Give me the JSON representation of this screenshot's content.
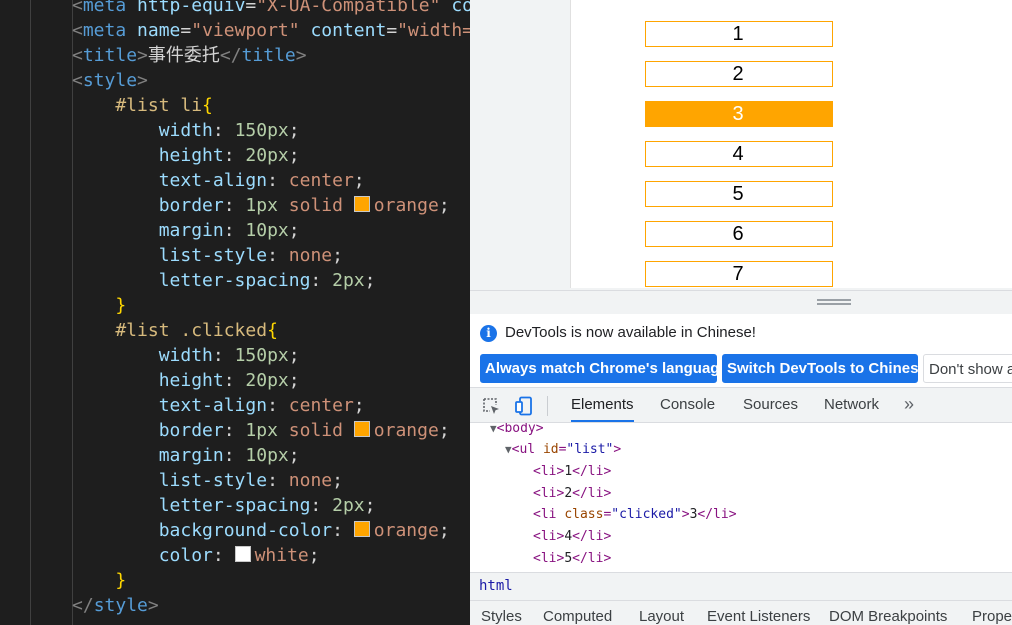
{
  "editor": {
    "lines": [
      [
        [
          "t-br",
          "<"
        ],
        [
          "t-tag",
          "meta "
        ],
        [
          "t-attr",
          "http-equiv"
        ],
        [
          "t-txt",
          "="
        ],
        [
          "t-str",
          "\"X-UA-Compatible\" "
        ],
        [
          "t-attr",
          "co"
        ]
      ],
      [
        [
          "t-br",
          "<"
        ],
        [
          "t-tag",
          "meta "
        ],
        [
          "t-attr",
          "name"
        ],
        [
          "t-txt",
          "="
        ],
        [
          "t-str",
          "\"viewport\" "
        ],
        [
          "t-attr",
          "content"
        ],
        [
          "t-txt",
          "="
        ],
        [
          "t-str",
          "\"width="
        ]
      ],
      [
        [
          "t-br",
          "<"
        ],
        [
          "t-tag",
          "title"
        ],
        [
          "t-br",
          ">"
        ],
        [
          "t-txt",
          "事件委托"
        ],
        [
          "t-br",
          "</"
        ],
        [
          "t-tag",
          "title"
        ],
        [
          "t-br",
          ">"
        ]
      ],
      [
        [
          "t-br",
          "<"
        ],
        [
          "t-tag",
          "style"
        ],
        [
          "t-br",
          ">"
        ]
      ],
      [
        [
          "t-sel",
          "    #list li"
        ],
        [
          "t-brace",
          "{"
        ]
      ],
      [
        [
          "t-prop",
          "        width"
        ],
        [
          "t-pun",
          ": "
        ],
        [
          "t-num",
          "150px"
        ],
        [
          "t-pun",
          ";"
        ]
      ],
      [
        [
          "t-prop",
          "        height"
        ],
        [
          "t-pun",
          ": "
        ],
        [
          "t-num",
          "20px"
        ],
        [
          "t-pun",
          ";"
        ]
      ],
      [
        [
          "t-prop",
          "        text-align"
        ],
        [
          "t-pun",
          ": "
        ],
        [
          "t-val",
          "center"
        ],
        [
          "t-pun",
          ";"
        ]
      ],
      [
        [
          "t-prop",
          "        border"
        ],
        [
          "t-pun",
          ": "
        ],
        [
          "t-num",
          "1px "
        ],
        [
          "t-val",
          "solid "
        ],
        [
          "swatch",
          "#FFA500"
        ],
        [
          "t-val",
          "orange"
        ],
        [
          "t-pun",
          ";"
        ]
      ],
      [
        [
          "t-prop",
          "        margin"
        ],
        [
          "t-pun",
          ": "
        ],
        [
          "t-num",
          "10px"
        ],
        [
          "t-pun",
          ";"
        ]
      ],
      [
        [
          "t-prop",
          "        list-style"
        ],
        [
          "t-pun",
          ": "
        ],
        [
          "t-val",
          "none"
        ],
        [
          "t-pun",
          ";"
        ]
      ],
      [
        [
          "t-prop",
          "        letter-spacing"
        ],
        [
          "t-pun",
          ": "
        ],
        [
          "t-num",
          "2px"
        ],
        [
          "t-pun",
          ";"
        ]
      ],
      [
        [
          "t-brace",
          "    }"
        ]
      ],
      [
        [
          "t-sel",
          "    #list .clicked"
        ],
        [
          "t-brace",
          "{"
        ]
      ],
      [
        [
          "t-prop",
          "        width"
        ],
        [
          "t-pun",
          ": "
        ],
        [
          "t-num",
          "150px"
        ],
        [
          "t-pun",
          ";"
        ]
      ],
      [
        [
          "t-prop",
          "        height"
        ],
        [
          "t-pun",
          ": "
        ],
        [
          "t-num",
          "20px"
        ],
        [
          "t-pun",
          ";"
        ]
      ],
      [
        [
          "t-prop",
          "        text-align"
        ],
        [
          "t-pun",
          ": "
        ],
        [
          "t-val",
          "center"
        ],
        [
          "t-pun",
          ";"
        ]
      ],
      [
        [
          "t-prop",
          "        border"
        ],
        [
          "t-pun",
          ": "
        ],
        [
          "t-num",
          "1px "
        ],
        [
          "t-val",
          "solid "
        ],
        [
          "swatch",
          "#FFA500"
        ],
        [
          "t-val",
          "orange"
        ],
        [
          "t-pun",
          ";"
        ]
      ],
      [
        [
          "t-prop",
          "        margin"
        ],
        [
          "t-pun",
          ": "
        ],
        [
          "t-num",
          "10px"
        ],
        [
          "t-pun",
          ";"
        ]
      ],
      [
        [
          "t-prop",
          "        list-style"
        ],
        [
          "t-pun",
          ": "
        ],
        [
          "t-val",
          "none"
        ],
        [
          "t-pun",
          ";"
        ]
      ],
      [
        [
          "t-prop",
          "        letter-spacing"
        ],
        [
          "t-pun",
          ": "
        ],
        [
          "t-num",
          "2px"
        ],
        [
          "t-pun",
          ";"
        ]
      ],
      [
        [
          "t-prop",
          "        background-color"
        ],
        [
          "t-pun",
          ": "
        ],
        [
          "swatch",
          "#FFA500"
        ],
        [
          "t-val",
          "orange"
        ],
        [
          "t-pun",
          ";"
        ]
      ],
      [
        [
          "t-prop",
          "        color"
        ],
        [
          "t-pun",
          ": "
        ],
        [
          "swatch",
          "#FFFFFF"
        ],
        [
          "t-val",
          "white"
        ],
        [
          "t-pun",
          ";"
        ]
      ],
      [
        [
          "t-brace",
          "    }"
        ]
      ],
      [
        [
          "t-br",
          "</"
        ],
        [
          "t-tag",
          "style"
        ],
        [
          "t-br",
          ">"
        ]
      ]
    ]
  },
  "page": {
    "list_items": [
      "1",
      "2",
      "3",
      "4",
      "5",
      "6",
      "7"
    ],
    "clicked_index": 2,
    "accent_color": "#FFA500"
  },
  "devtools": {
    "info_text": "DevTools is now available in Chinese!",
    "btn_match": "Always match Chrome's language",
    "btn_switch": "Switch DevTools to Chinese",
    "btn_dont_show": "Don't show a",
    "tabs": [
      "Elements",
      "Console",
      "Sources",
      "Network"
    ],
    "active_tab": "Elements",
    "tree": {
      "body_tag": "<body>",
      "ul_open": "<ul ",
      "ul_attr_name": "id",
      "ul_attr_value": "\"list\"",
      "li_items": [
        "1",
        "2",
        "3",
        "4",
        "5"
      ],
      "li_class_attr": "class",
      "li_class_value": "\"clicked\""
    },
    "breadcrumb": "html",
    "subtabs": [
      "Styles",
      "Computed",
      "Layout",
      "Event Listeners",
      "DOM Breakpoints",
      "Prope"
    ],
    "brand_color": "#1a73e8"
  }
}
